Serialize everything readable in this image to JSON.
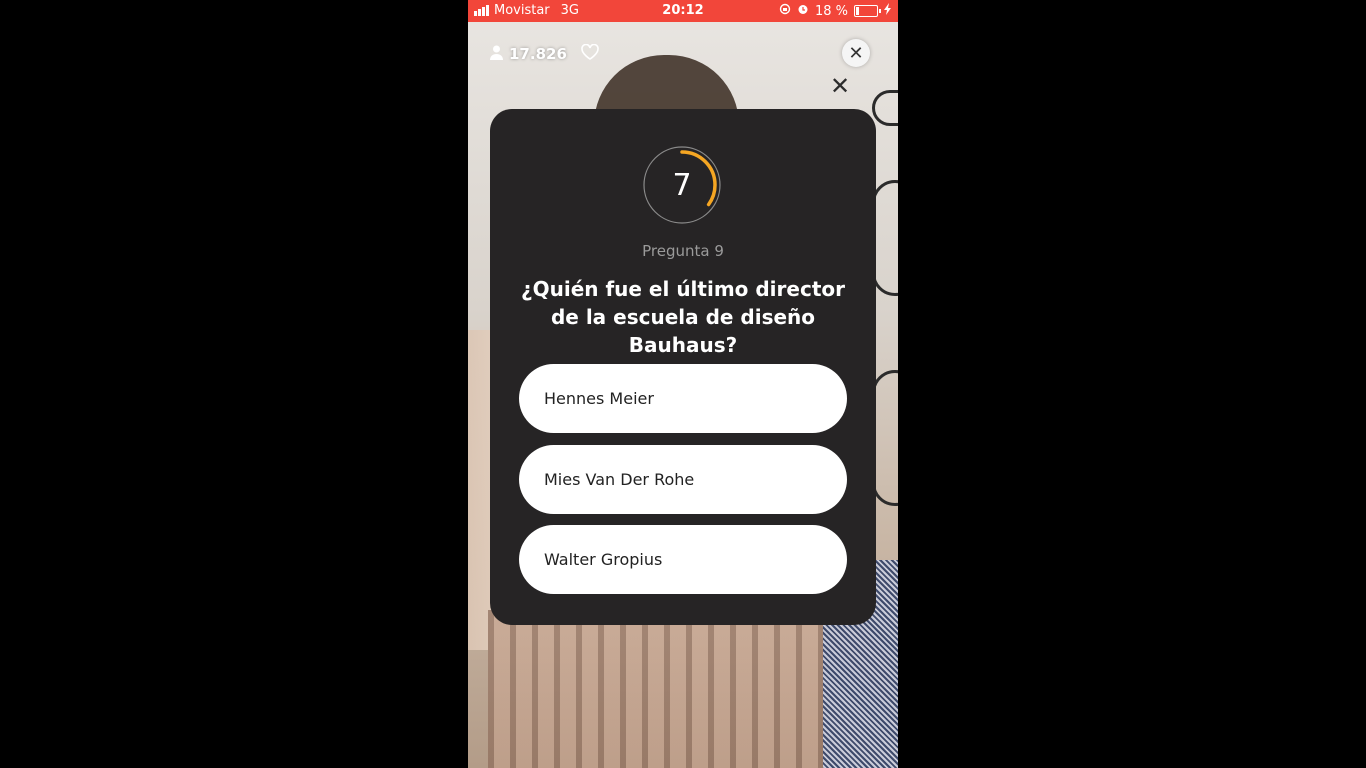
{
  "status_bar": {
    "carrier": "Movistar",
    "network": "3G",
    "time": "20:12",
    "battery_text": "18 %",
    "battery_level": 0.18,
    "icons": [
      "signal-bars-icon",
      "rotation-lock-icon",
      "alarm-icon",
      "battery-icon",
      "charging-bolt-icon"
    ]
  },
  "header": {
    "viewer_count": "17.826",
    "icons": [
      "person-icon",
      "heart-icon",
      "close-icon"
    ]
  },
  "quiz": {
    "timer_value": "7",
    "timer_progress": 0.35,
    "question_label": "Pregunta 9",
    "question_text": "¿Quién fue el último director de la escuela de diseño Bauhaus?",
    "answers": [
      {
        "label": "Hennes Meier"
      },
      {
        "label": "Mies Van Der Rohe"
      },
      {
        "label": "Walter Gropius"
      }
    ]
  },
  "colors": {
    "status_bar": "#f2463a",
    "card": "#262425",
    "timer_ring": "#f5a623",
    "answer_bg": "#ffffff"
  }
}
